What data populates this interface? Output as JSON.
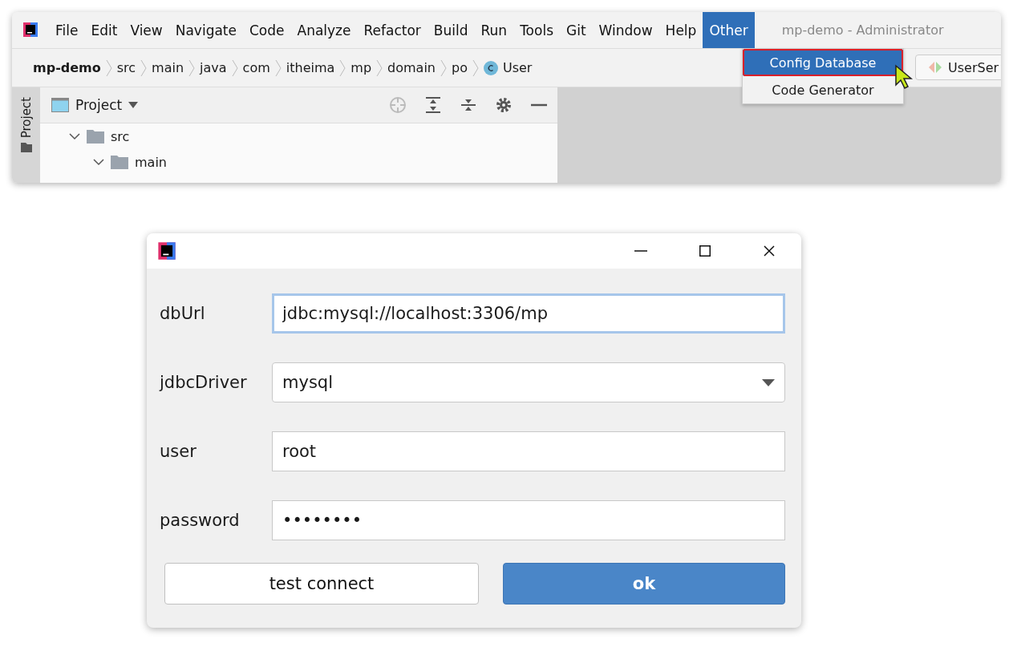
{
  "ide": {
    "menu": [
      {
        "label": "File",
        "selected": false
      },
      {
        "label": "Edit",
        "selected": false
      },
      {
        "label": "View",
        "selected": false
      },
      {
        "label": "Navigate",
        "selected": false
      },
      {
        "label": "Code",
        "selected": false
      },
      {
        "label": "Analyze",
        "selected": false
      },
      {
        "label": "Refactor",
        "selected": false
      },
      {
        "label": "Build",
        "selected": false
      },
      {
        "label": "Run",
        "selected": false
      },
      {
        "label": "Tools",
        "selected": false
      },
      {
        "label": "Git",
        "selected": false
      },
      {
        "label": "Window",
        "selected": false
      },
      {
        "label": "Help",
        "selected": false
      },
      {
        "label": "Other",
        "selected": true
      }
    ],
    "title": "mp-demo - Administrator",
    "dropdown": [
      {
        "label": "Config Database",
        "selected": true
      },
      {
        "label": "Code Generator",
        "selected": false
      }
    ],
    "breadcrumbs": [
      "mp-demo",
      "src",
      "main",
      "java",
      "com",
      "itheima",
      "mp",
      "domain",
      "po",
      "User"
    ],
    "editor_tab": "UserSer",
    "side_tab": "Project",
    "panel_title": "Project",
    "tree": [
      {
        "label": "src",
        "expanded": true,
        "children": [
          {
            "label": "main",
            "expanded": true
          }
        ]
      }
    ]
  },
  "dialog": {
    "fields": [
      {
        "kind": "text",
        "label": "dbUrl",
        "value": "jdbc:mysql://localhost:3306/mp",
        "focused": true
      },
      {
        "kind": "select",
        "label": "jdbcDriver",
        "value": "mysql",
        "focused": false
      },
      {
        "kind": "text",
        "label": "user",
        "value": "root",
        "focused": false
      },
      {
        "kind": "text",
        "label": "password",
        "value": "••••••••",
        "focused": false
      }
    ],
    "buttons": [
      {
        "label": "test connect",
        "primary": false
      },
      {
        "label": "ok",
        "primary": true
      }
    ]
  }
}
